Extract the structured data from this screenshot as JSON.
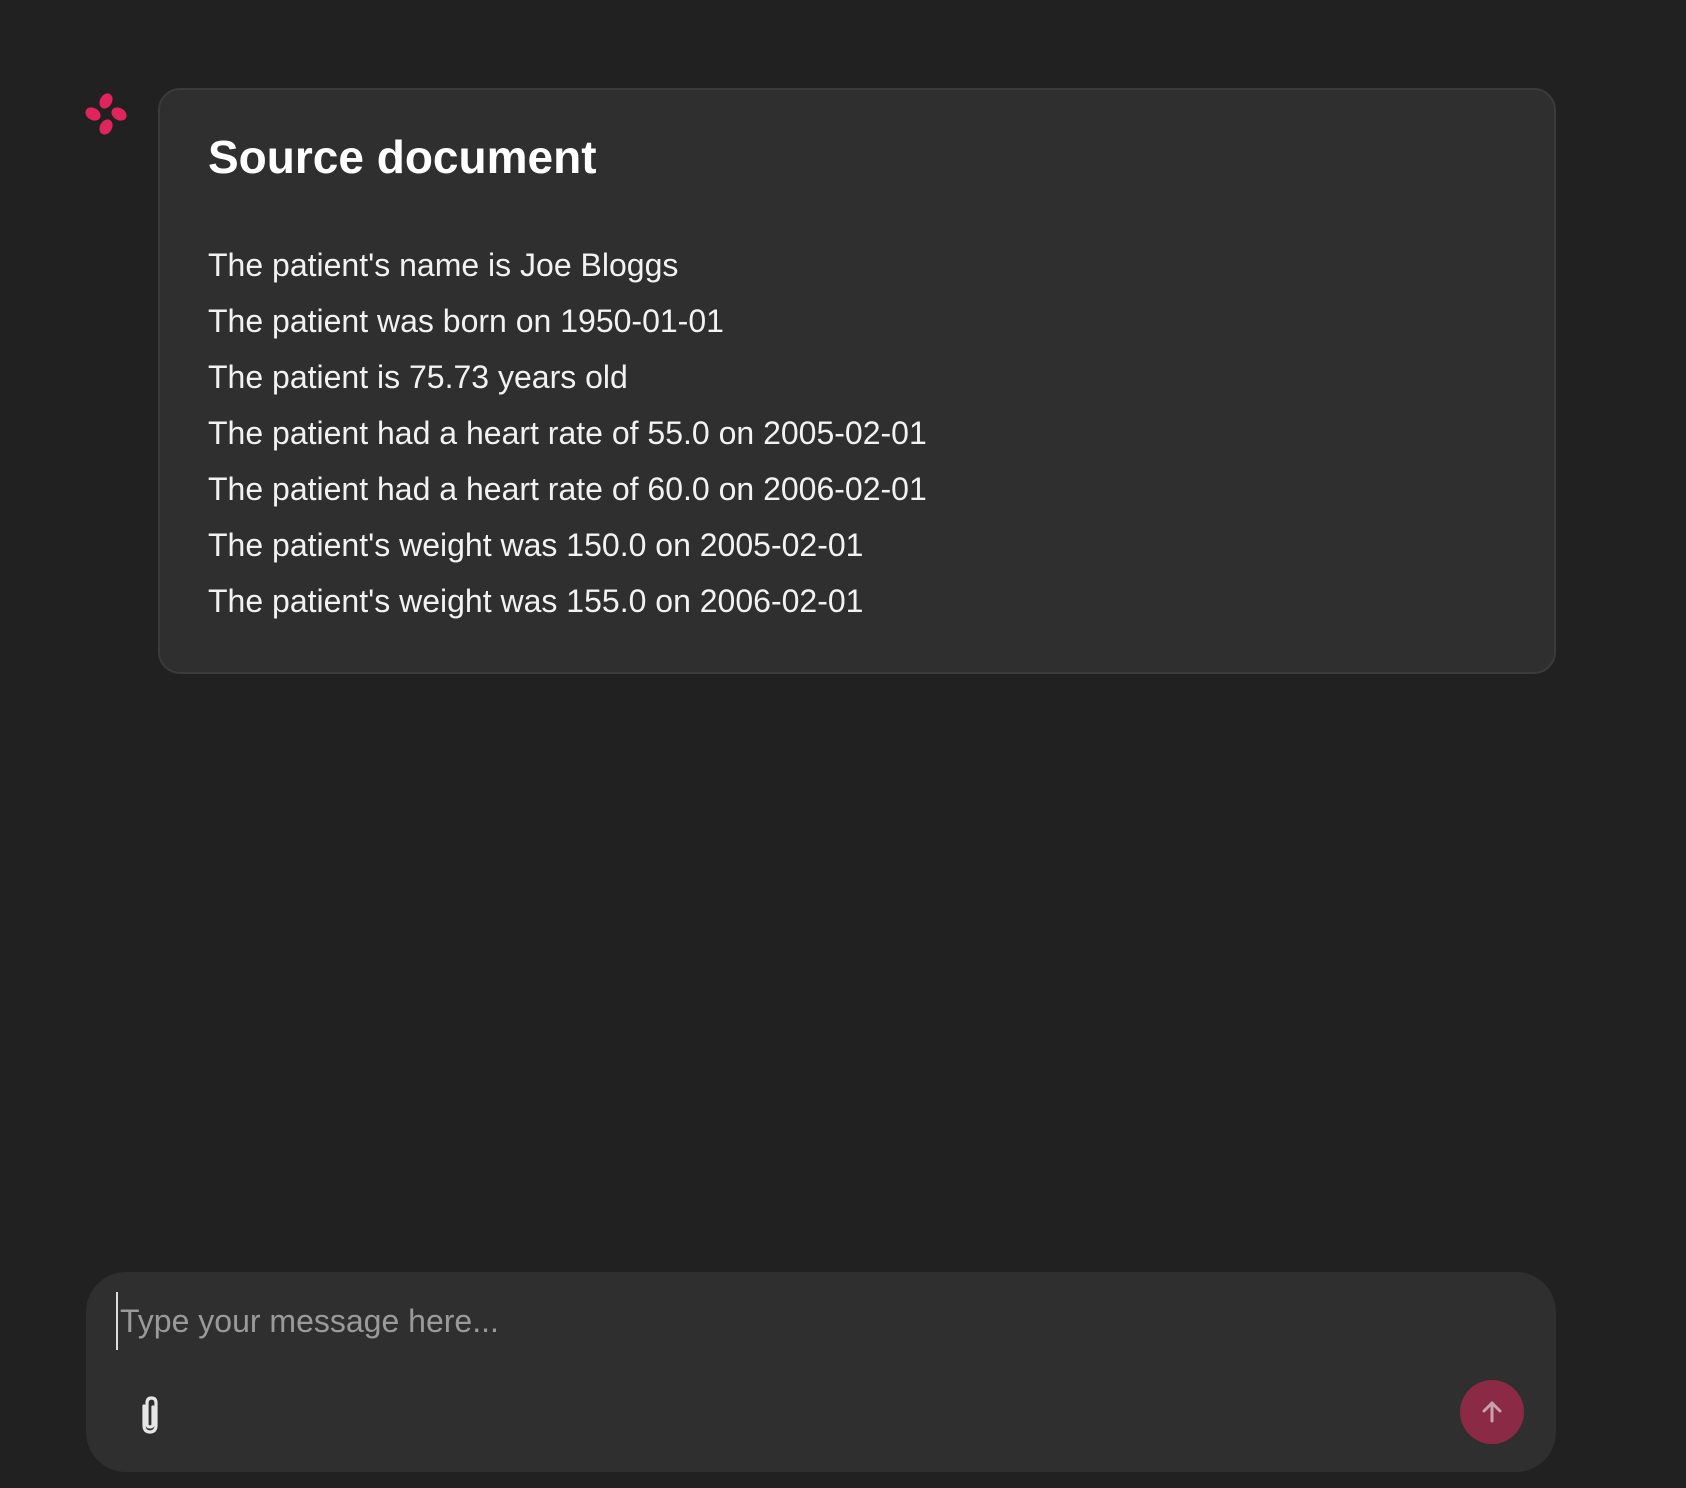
{
  "colors": {
    "background": "#212121",
    "card": "#2f2f2f",
    "brand_accent": "#e0245e",
    "send_button": "#8a2a45"
  },
  "assistant": {
    "avatar_icon": "four-petal-logo-icon"
  },
  "message": {
    "title": "Source document",
    "lines": [
      "The patient's name is Joe Bloggs",
      "The patient was born on 1950-01-01",
      "The patient is 75.73 years old",
      "The patient had a heart rate of 55.0 on 2005-02-01",
      "The patient had a heart rate of 60.0 on 2006-02-01",
      "The patient's weight was 150.0 on 2005-02-01",
      "The patient's weight was 155.0 on 2006-02-01"
    ]
  },
  "composer": {
    "placeholder": "Type your message here...",
    "value": "",
    "attach_icon": "paperclip-icon",
    "send_icon": "arrow-up-icon"
  }
}
